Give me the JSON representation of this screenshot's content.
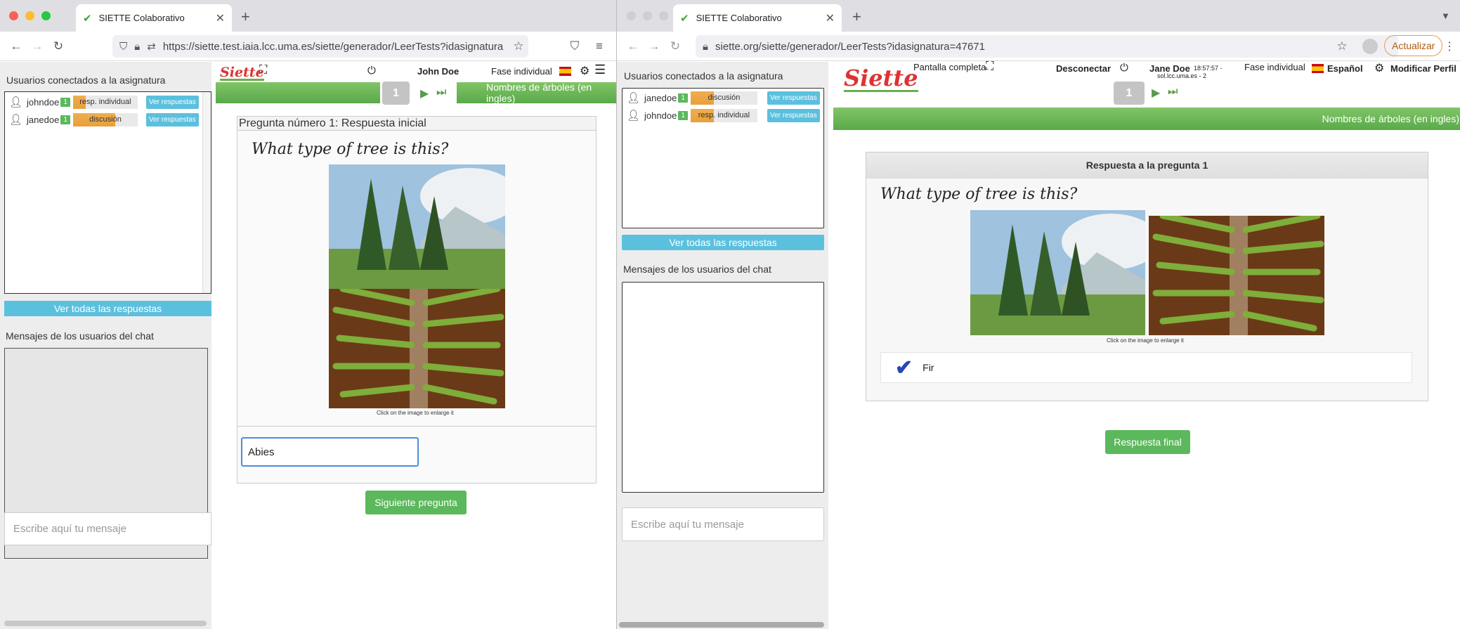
{
  "left": {
    "tab_title": "SIETTE Colaborativo",
    "url": "https://siette.test.iaia.lcc.uma.es/siette/generador/LeerTests?idasignatura",
    "sidebar_title": "Usuarios conectados a la asignatura",
    "users": [
      {
        "name": "johndoe",
        "badge": "1",
        "status": "resp. individual",
        "progress": 0.2,
        "button": "Ver respuestas"
      },
      {
        "name": "janedoe",
        "badge": "1",
        "status": "discusión",
        "progress": 0.65,
        "button": "Ver respuestas"
      }
    ],
    "all_answers_button": "Ver todas las respuestas",
    "chat_title": "Mensajes de los usuarios del chat",
    "chat_placeholder": "Escribe aquí tu mensaje",
    "logo": "Siette",
    "user_name": "John Doe",
    "phase": "Fase individual",
    "page_number": "1",
    "test_name": "Nombres de árboles (en ingles)",
    "panel_title": "Pregunta número 1: Respuesta inicial",
    "question": "What type of tree is this?",
    "image_caption": "Click on the image to enlarge it",
    "answer_value": "Abies",
    "next_button": "Siguiente pregunta"
  },
  "right": {
    "tab_title": "SIETTE Colaborativo",
    "url": "siette.org/siette/generador/LeerTests?idasignatura=47671",
    "update_button": "Actualizar",
    "sidebar_title": "Usuarios conectados a la asignatura",
    "users": [
      {
        "name": "janedoe",
        "badge": "1",
        "status": "discusión",
        "progress": 0.35,
        "button": "Ver respuestas"
      },
      {
        "name": "johndoe",
        "badge": "1",
        "status": "resp. individual",
        "progress": 0.35,
        "button": "Ver respuestas"
      }
    ],
    "all_answers_button": "Ver todas las respuestas",
    "chat_title": "Mensajes de los usuarios del chat",
    "chat_placeholder": "Escribe aquí tu mensaje",
    "logo": "Siette",
    "fullscreen": "Pantalla completa",
    "disconnect": "Desconectar",
    "user_name": "Jane Doe",
    "time": "18:57:57 -",
    "host": "sol.lcc.uma.es - 2",
    "phase": "Fase individual",
    "language": "Español",
    "profile": "Modificar Perfil",
    "page_number": "1",
    "test_name": "Nombres de árboles (en ingles)",
    "panel_title": "Respuesta a la pregunta 1",
    "question": "What type of tree is this?",
    "image_caption": "Click on the image to enlarge it",
    "answer": "Fir",
    "final_button": "Respuesta final"
  },
  "colors": {
    "green": "#5cb85c",
    "blue": "#5bc0de",
    "orange": "#f0ad4e",
    "logo_red": "#dd3333"
  }
}
